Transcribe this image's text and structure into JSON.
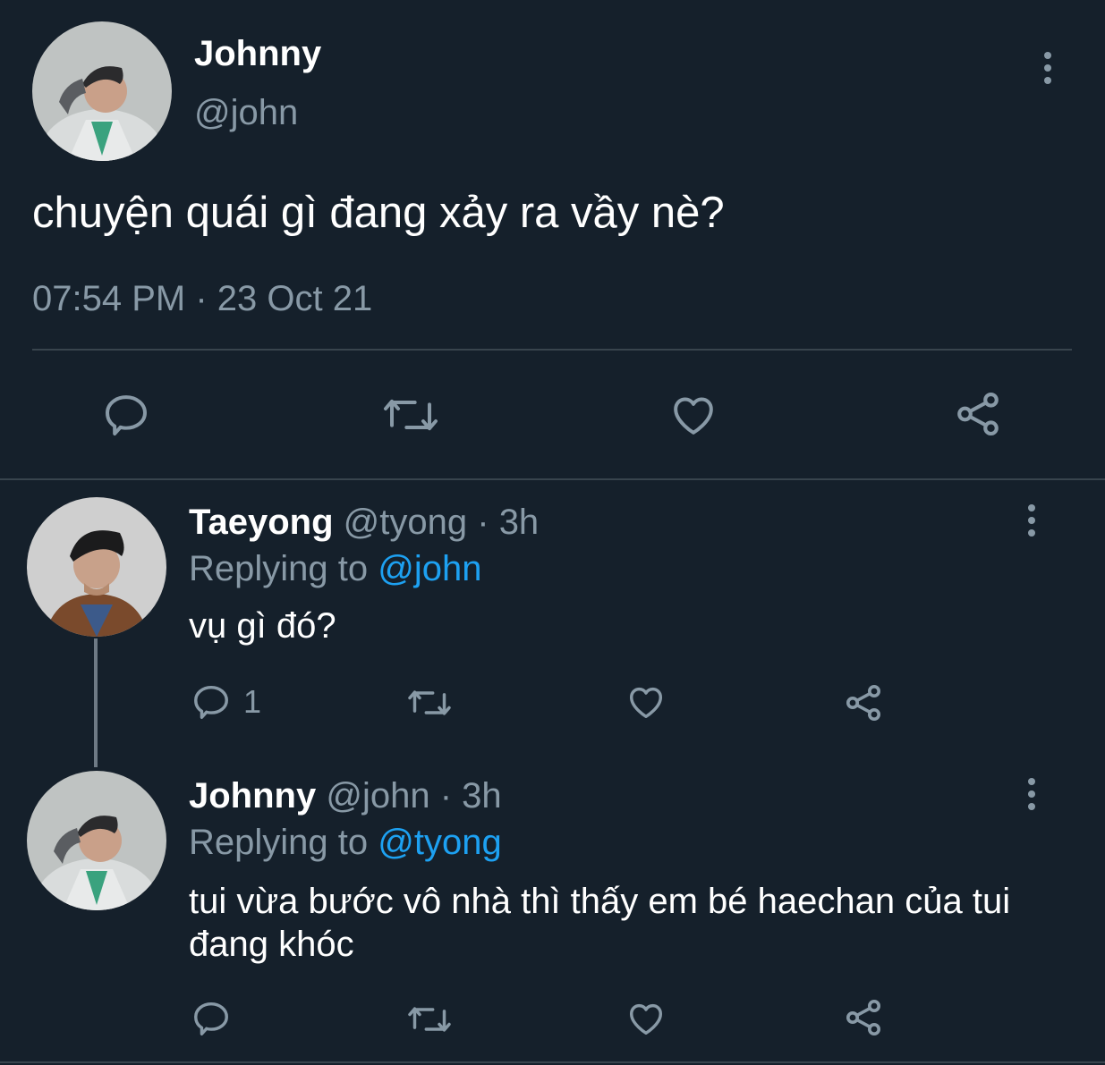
{
  "main_tweet": {
    "display_name": "Johnny",
    "handle": "@john",
    "text": "chuyện quái gì đang xảy ra vầy nè?",
    "timestamp": "07:54 PM · 23 Oct 21",
    "actions": [
      "reply-icon",
      "retweet-icon",
      "like-icon",
      "share-icon"
    ]
  },
  "replies": [
    {
      "display_name": "Taeyong",
      "handle": "@tyong",
      "separator": "·",
      "time": "3h",
      "replying_label": "Replying to",
      "replying_to": "@john",
      "text": "vụ gì đó?",
      "reply_count": "1"
    },
    {
      "display_name": "Johnny",
      "handle": "@john",
      "separator": "·",
      "time": "3h",
      "replying_label": "Replying to",
      "replying_to": "@tyong",
      "text": "tui vừa bước vô nhà thì thấy em bé haechan của tui đang khóc",
      "reply_count": ""
    }
  ],
  "colors": {
    "background": "#15202b",
    "text": "#ffffff",
    "muted": "#8899a6",
    "link": "#1da1f2",
    "divider": "#38444d"
  }
}
